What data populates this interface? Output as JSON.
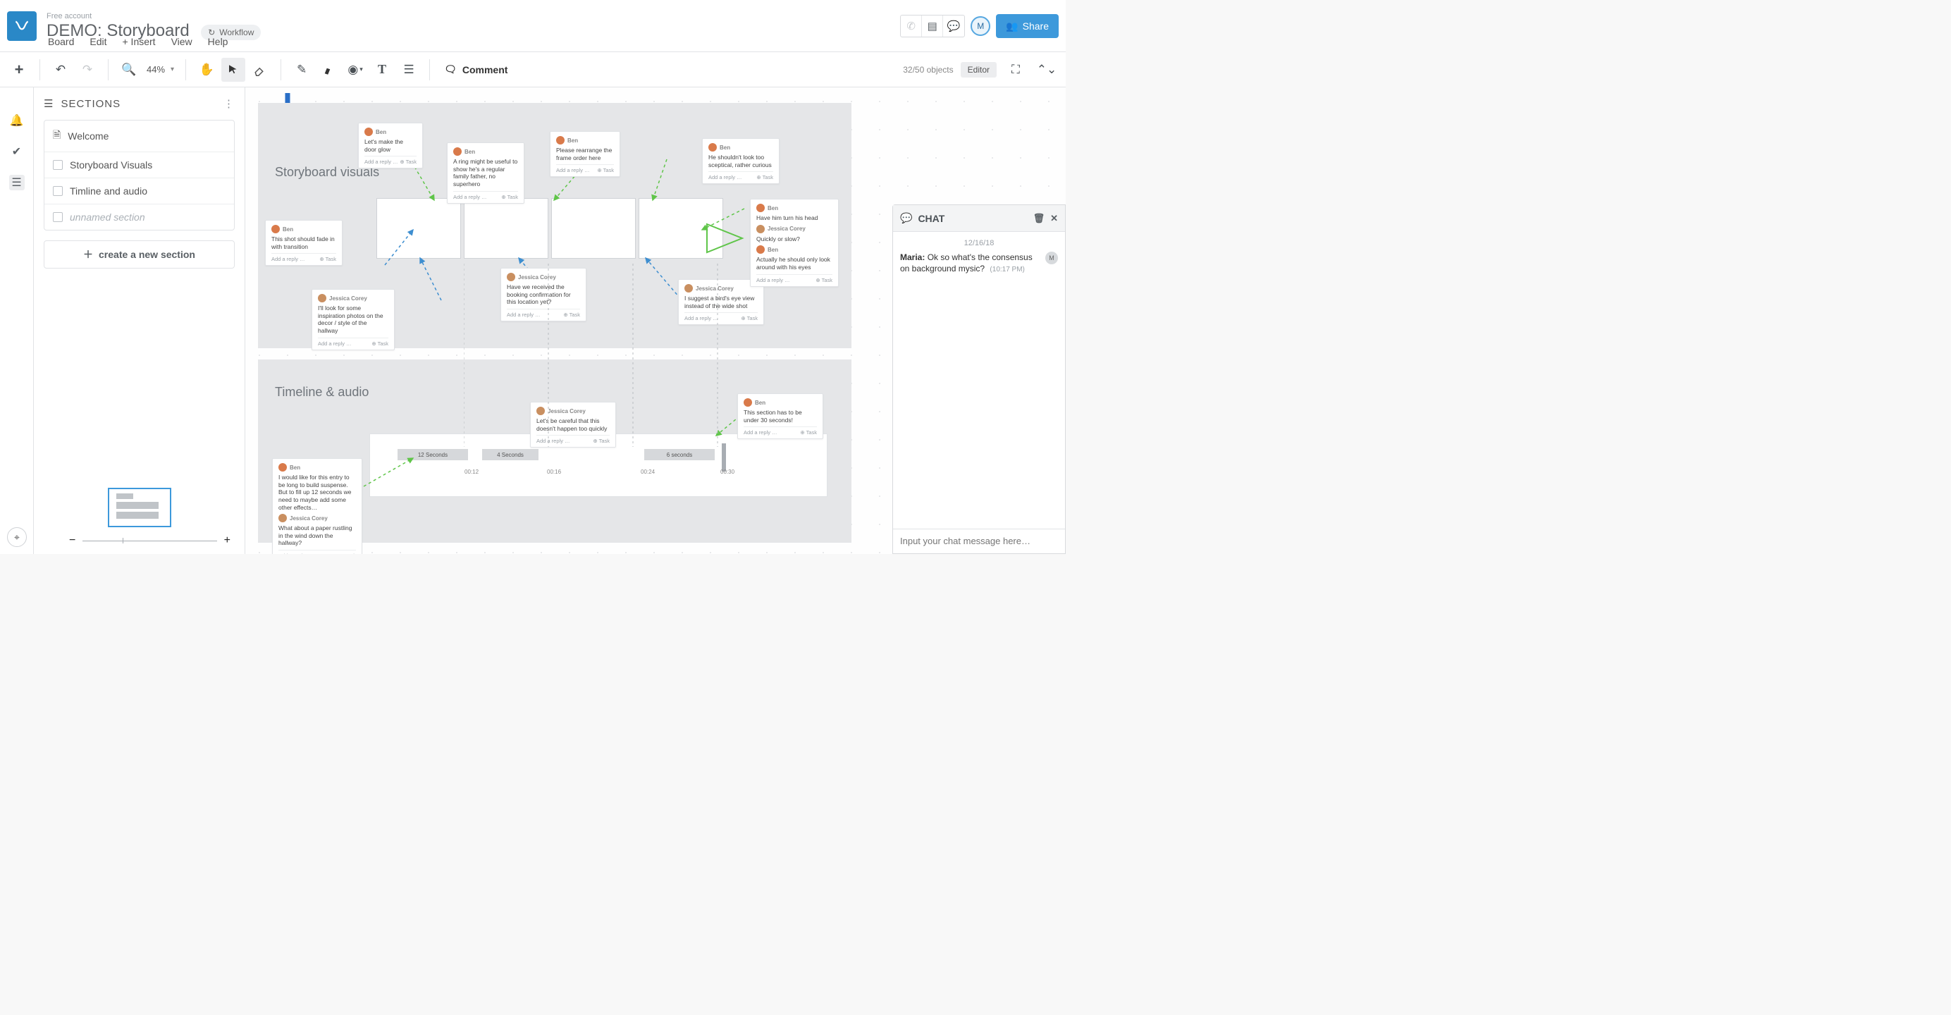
{
  "user": {
    "name": "Maria"
  },
  "header": {
    "account_tier": "Free account",
    "board_title": "DEMO: Storyboard",
    "workflow_label": "Workflow",
    "menu": {
      "board": "Board",
      "edit": "Edit",
      "insert": "+ Insert",
      "view": "View",
      "help": "Help"
    },
    "share_label": "Share"
  },
  "toolbar": {
    "zoom": "44%",
    "comment_label": "Comment",
    "object_count": "32/50 objects",
    "mode_label": "Editor"
  },
  "sidebar": {
    "title": "SECTIONS",
    "items": [
      {
        "label": "Welcome",
        "icon": "page"
      },
      {
        "label": "Storyboard Visuals",
        "icon": "checkbox"
      },
      {
        "label": "Timline and audio",
        "icon": "checkbox"
      },
      {
        "label": "unnamed section",
        "icon": "checkbox",
        "italic": true
      }
    ],
    "create_label": "create a new section"
  },
  "canvas": {
    "section1_title": "Storyboard visuals",
    "section2_title": "Timeline & audio",
    "notes": {
      "n1": {
        "user": "Ben",
        "text": "Let's make the door glow"
      },
      "n2": {
        "user": "Ben",
        "text": "A ring might be useful to show he's a regular family father, no superhero"
      },
      "n3": {
        "user": "Ben",
        "text": "Please rearrange the frame order here"
      },
      "n4": {
        "user": "Ben",
        "text": "He shouldn't look too sceptical, rather curious"
      },
      "n5": {
        "user": "Ben",
        "text": "This shot should fade in with transition"
      },
      "n6": {
        "user": "Jessica Corey",
        "text": "I'll look for some inspiration photos on the decor / style of the hallway"
      },
      "n7": {
        "user": "Jessica Corey",
        "text": "Have we received the booking confirmation for this location yet?"
      },
      "n8": {
        "user": "Jessica Corey",
        "text": "I suggest a bird's eye view instead of the wide shot"
      },
      "n9a": {
        "user": "Ben",
        "text": "Have him turn his head"
      },
      "n9b": {
        "user": "Jessica Corey",
        "text": "Quickly or slow?"
      },
      "n9c": {
        "user": "Ben",
        "text": "Actually he should only look around with his eyes"
      },
      "n10": {
        "user": "Jessica Corey",
        "text": "Let's be careful that this doesn't happen too quickly"
      },
      "n11": {
        "user": "Ben",
        "text": "This section has to be under 30 seconds!"
      },
      "n12a": {
        "user": "Ben",
        "text": "I would like for this entry to be long to build suspense. But to fill up 12 seconds we need to maybe add some other effects…"
      },
      "n12b": {
        "user": "Jessica Corey",
        "text": "What about a paper rustling in the wind down the hallway?"
      },
      "reply_placeholder": "Add a reply …",
      "task_label": "Task"
    },
    "timeline": {
      "segments": [
        {
          "label": "12 Seconds"
        },
        {
          "label": "4 Seconds"
        },
        {
          "label": "6 seconds"
        }
      ],
      "ticks": [
        "00:12",
        "00:16",
        "00:24",
        "00:30"
      ]
    }
  },
  "chat": {
    "title": "CHAT",
    "date": "12/16/18",
    "message": {
      "author": "Maria:",
      "text": "Ok so what's the consensus on background mysic?",
      "time": "(10:17 PM)",
      "avatar_initial": "M"
    },
    "input_placeholder": "Input your chat message here…"
  },
  "avatar_initial": "M"
}
